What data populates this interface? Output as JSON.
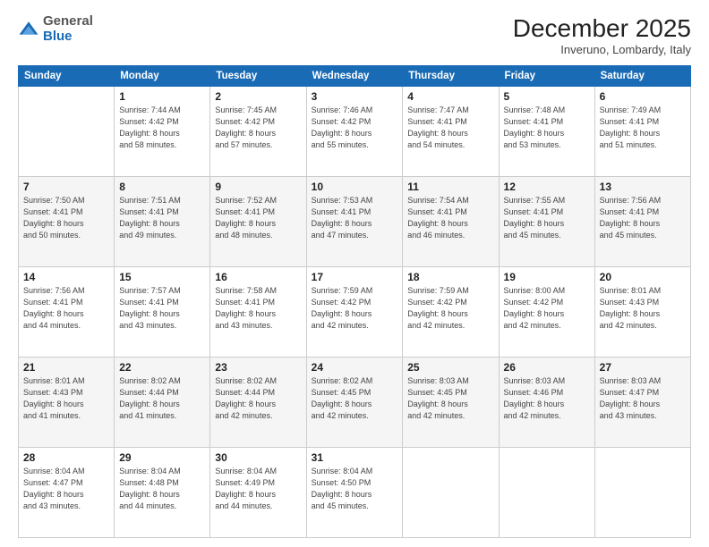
{
  "logo": {
    "general": "General",
    "blue": "Blue"
  },
  "title": "December 2025",
  "location": "Inveruno, Lombardy, Italy",
  "days_header": [
    "Sunday",
    "Monday",
    "Tuesday",
    "Wednesday",
    "Thursday",
    "Friday",
    "Saturday"
  ],
  "weeks": [
    [
      {
        "day": "",
        "info": ""
      },
      {
        "day": "1",
        "info": "Sunrise: 7:44 AM\nSunset: 4:42 PM\nDaylight: 8 hours\nand 58 minutes."
      },
      {
        "day": "2",
        "info": "Sunrise: 7:45 AM\nSunset: 4:42 PM\nDaylight: 8 hours\nand 57 minutes."
      },
      {
        "day": "3",
        "info": "Sunrise: 7:46 AM\nSunset: 4:42 PM\nDaylight: 8 hours\nand 55 minutes."
      },
      {
        "day": "4",
        "info": "Sunrise: 7:47 AM\nSunset: 4:41 PM\nDaylight: 8 hours\nand 54 minutes."
      },
      {
        "day": "5",
        "info": "Sunrise: 7:48 AM\nSunset: 4:41 PM\nDaylight: 8 hours\nand 53 minutes."
      },
      {
        "day": "6",
        "info": "Sunrise: 7:49 AM\nSunset: 4:41 PM\nDaylight: 8 hours\nand 51 minutes."
      }
    ],
    [
      {
        "day": "7",
        "info": "Sunrise: 7:50 AM\nSunset: 4:41 PM\nDaylight: 8 hours\nand 50 minutes."
      },
      {
        "day": "8",
        "info": "Sunrise: 7:51 AM\nSunset: 4:41 PM\nDaylight: 8 hours\nand 49 minutes."
      },
      {
        "day": "9",
        "info": "Sunrise: 7:52 AM\nSunset: 4:41 PM\nDaylight: 8 hours\nand 48 minutes."
      },
      {
        "day": "10",
        "info": "Sunrise: 7:53 AM\nSunset: 4:41 PM\nDaylight: 8 hours\nand 47 minutes."
      },
      {
        "day": "11",
        "info": "Sunrise: 7:54 AM\nSunset: 4:41 PM\nDaylight: 8 hours\nand 46 minutes."
      },
      {
        "day": "12",
        "info": "Sunrise: 7:55 AM\nSunset: 4:41 PM\nDaylight: 8 hours\nand 45 minutes."
      },
      {
        "day": "13",
        "info": "Sunrise: 7:56 AM\nSunset: 4:41 PM\nDaylight: 8 hours\nand 45 minutes."
      }
    ],
    [
      {
        "day": "14",
        "info": "Sunrise: 7:56 AM\nSunset: 4:41 PM\nDaylight: 8 hours\nand 44 minutes."
      },
      {
        "day": "15",
        "info": "Sunrise: 7:57 AM\nSunset: 4:41 PM\nDaylight: 8 hours\nand 43 minutes."
      },
      {
        "day": "16",
        "info": "Sunrise: 7:58 AM\nSunset: 4:41 PM\nDaylight: 8 hours\nand 43 minutes."
      },
      {
        "day": "17",
        "info": "Sunrise: 7:59 AM\nSunset: 4:42 PM\nDaylight: 8 hours\nand 42 minutes."
      },
      {
        "day": "18",
        "info": "Sunrise: 7:59 AM\nSunset: 4:42 PM\nDaylight: 8 hours\nand 42 minutes."
      },
      {
        "day": "19",
        "info": "Sunrise: 8:00 AM\nSunset: 4:42 PM\nDaylight: 8 hours\nand 42 minutes."
      },
      {
        "day": "20",
        "info": "Sunrise: 8:01 AM\nSunset: 4:43 PM\nDaylight: 8 hours\nand 42 minutes."
      }
    ],
    [
      {
        "day": "21",
        "info": "Sunrise: 8:01 AM\nSunset: 4:43 PM\nDaylight: 8 hours\nand 41 minutes."
      },
      {
        "day": "22",
        "info": "Sunrise: 8:02 AM\nSunset: 4:44 PM\nDaylight: 8 hours\nand 41 minutes."
      },
      {
        "day": "23",
        "info": "Sunrise: 8:02 AM\nSunset: 4:44 PM\nDaylight: 8 hours\nand 42 minutes."
      },
      {
        "day": "24",
        "info": "Sunrise: 8:02 AM\nSunset: 4:45 PM\nDaylight: 8 hours\nand 42 minutes."
      },
      {
        "day": "25",
        "info": "Sunrise: 8:03 AM\nSunset: 4:45 PM\nDaylight: 8 hours\nand 42 minutes."
      },
      {
        "day": "26",
        "info": "Sunrise: 8:03 AM\nSunset: 4:46 PM\nDaylight: 8 hours\nand 42 minutes."
      },
      {
        "day": "27",
        "info": "Sunrise: 8:03 AM\nSunset: 4:47 PM\nDaylight: 8 hours\nand 43 minutes."
      }
    ],
    [
      {
        "day": "28",
        "info": "Sunrise: 8:04 AM\nSunset: 4:47 PM\nDaylight: 8 hours\nand 43 minutes."
      },
      {
        "day": "29",
        "info": "Sunrise: 8:04 AM\nSunset: 4:48 PM\nDaylight: 8 hours\nand 44 minutes."
      },
      {
        "day": "30",
        "info": "Sunrise: 8:04 AM\nSunset: 4:49 PM\nDaylight: 8 hours\nand 44 minutes."
      },
      {
        "day": "31",
        "info": "Sunrise: 8:04 AM\nSunset: 4:50 PM\nDaylight: 8 hours\nand 45 minutes."
      },
      {
        "day": "",
        "info": ""
      },
      {
        "day": "",
        "info": ""
      },
      {
        "day": "",
        "info": ""
      }
    ]
  ]
}
